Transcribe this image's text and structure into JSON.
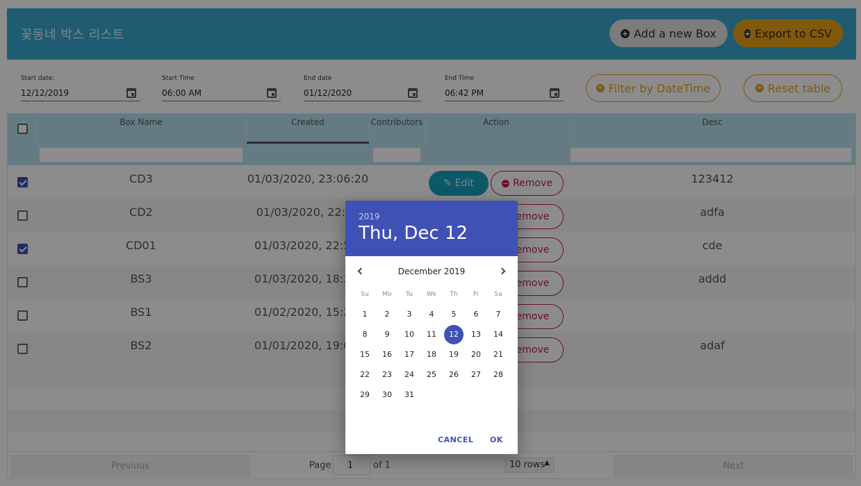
{
  "header": {
    "title": "꽃동네 박스 리스트",
    "add_label": "Add a new Box",
    "export_label": "Export to CSV"
  },
  "filters": {
    "start_date": {
      "label": "Start date:",
      "value": "12/12/2019"
    },
    "start_time": {
      "label": "Start Time",
      "value": "06:00 AM"
    },
    "end_date": {
      "label": "End date",
      "value": "01/12/2020"
    },
    "end_time": {
      "label": "End Time",
      "value": "06:42 PM"
    },
    "filter_label": "Filter by DateTime",
    "reset_label": "Reset table"
  },
  "table": {
    "columns": [
      "Box Name",
      "Created",
      "Contributors",
      "Action",
      "Desc"
    ],
    "edit_label": "Edit",
    "remove_label": "Remove",
    "rows": [
      {
        "checked": true,
        "name": "CD3",
        "created": "01/03/2020, 23:06:20",
        "desc": "123412"
      },
      {
        "checked": false,
        "name": "CD2",
        "created": "01/03/2020, 22:59",
        "desc": "adfa"
      },
      {
        "checked": true,
        "name": "CD01",
        "created": "01/03/2020, 22:50:",
        "desc": "cde"
      },
      {
        "checked": false,
        "name": "BS3",
        "created": "01/03/2020, 18:38:",
        "desc": "addd"
      },
      {
        "checked": false,
        "name": "BS1",
        "created": "01/02/2020, 15:23:",
        "desc": ""
      },
      {
        "checked": false,
        "name": "BS2",
        "created": "01/01/2020, 19:06:",
        "desc": "adaf"
      }
    ],
    "row_remove_labels": [
      "Remove",
      "emove",
      "emove",
      "emove",
      "emove",
      "emove"
    ]
  },
  "pager": {
    "previous": "Previous",
    "page_label": "Page",
    "page_value": "1",
    "of_label": "of 1",
    "rows_option": "10 rows",
    "next": "Next"
  },
  "datepicker": {
    "year": "2019",
    "selected_display": "Thu, Dec 12",
    "month_label": "December 2019",
    "weekdays": [
      "Su",
      "Mo",
      "Tu",
      "We",
      "Th",
      "Fr",
      "Sa"
    ],
    "first_weekday_index": 0,
    "days_in_month": 31,
    "selected_day": 12,
    "cancel_label": "CANCEL",
    "ok_label": "OK"
  },
  "colors": {
    "header_bg": "#3aa8cf",
    "accent_orange": "#eba318",
    "primary": "#3f51b5",
    "remove": "#c2185b",
    "edit": "#16a3c0"
  }
}
